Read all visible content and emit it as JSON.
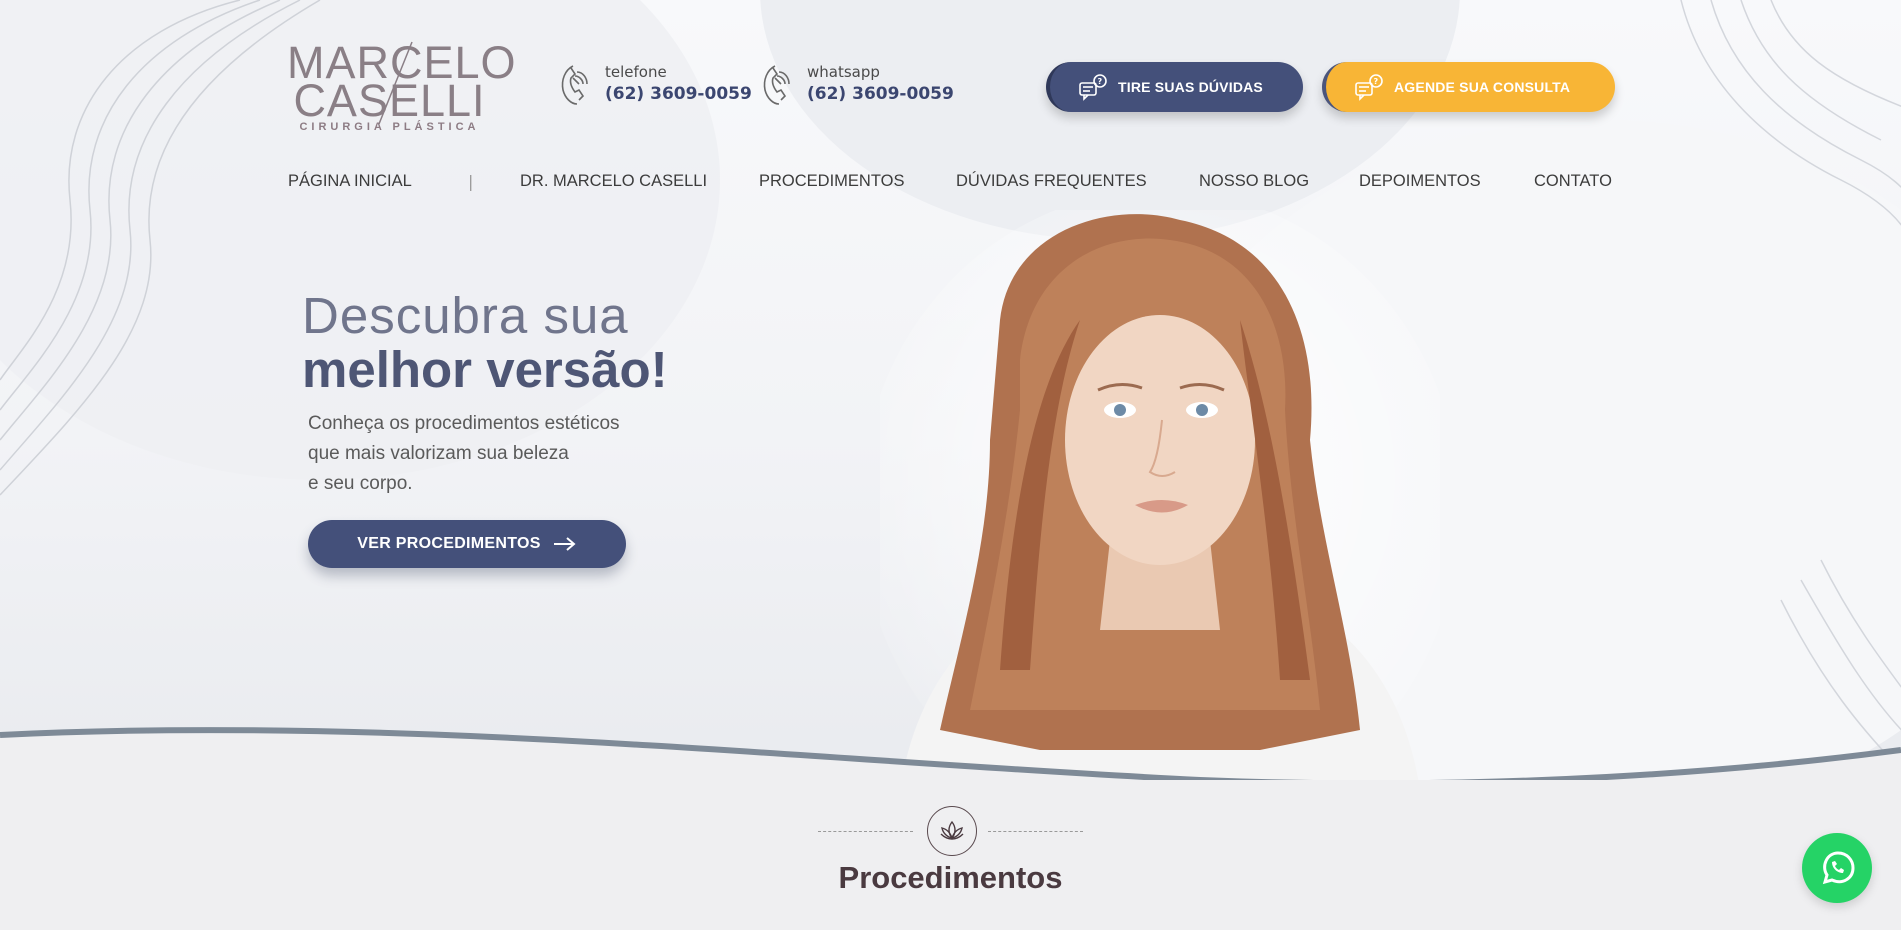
{
  "brand": {
    "logo_line1": "MARCELO",
    "logo_line2": "CASELLI",
    "logo_tagline": "CIRURGIA PLÁSTICA"
  },
  "contacts": [
    {
      "label": "telefone",
      "number": "(62) 3609-0059",
      "icon": "phone-icon"
    },
    {
      "label": "whatsapp",
      "number": "(62) 3609-0059",
      "icon": "phone-icon"
    }
  ],
  "header_buttons": {
    "duvidas": "TIRE SUAS DÚVIDAS",
    "consulta": "AGENDE SUA CONSULTA"
  },
  "nav": {
    "items": [
      "PÁGINA INICIAL",
      "DR. MARCELO CASELLI",
      "PROCEDIMENTOS",
      "DÚVIDAS FREQUENTES",
      "NOSSO BLOG",
      "DEPOIMENTOS",
      "CONTATO"
    ],
    "separator": "|"
  },
  "hero": {
    "title_line1": "Descubra sua",
    "title_line2": "melhor versão!",
    "subtitle_lines": [
      "Conheça os procedimentos estéticos",
      "que mais valorizam sua beleza",
      "e seu corpo."
    ],
    "cta": "VER PROCEDIMENTOS"
  },
  "section": {
    "title": "Procedimentos",
    "icon": "lotus-icon"
  },
  "float": {
    "icon": "whatsapp-icon"
  },
  "colors": {
    "primary": "#44507a",
    "accent": "#f8b536",
    "whatsapp": "#25d366",
    "heading": "#4a3a40"
  }
}
